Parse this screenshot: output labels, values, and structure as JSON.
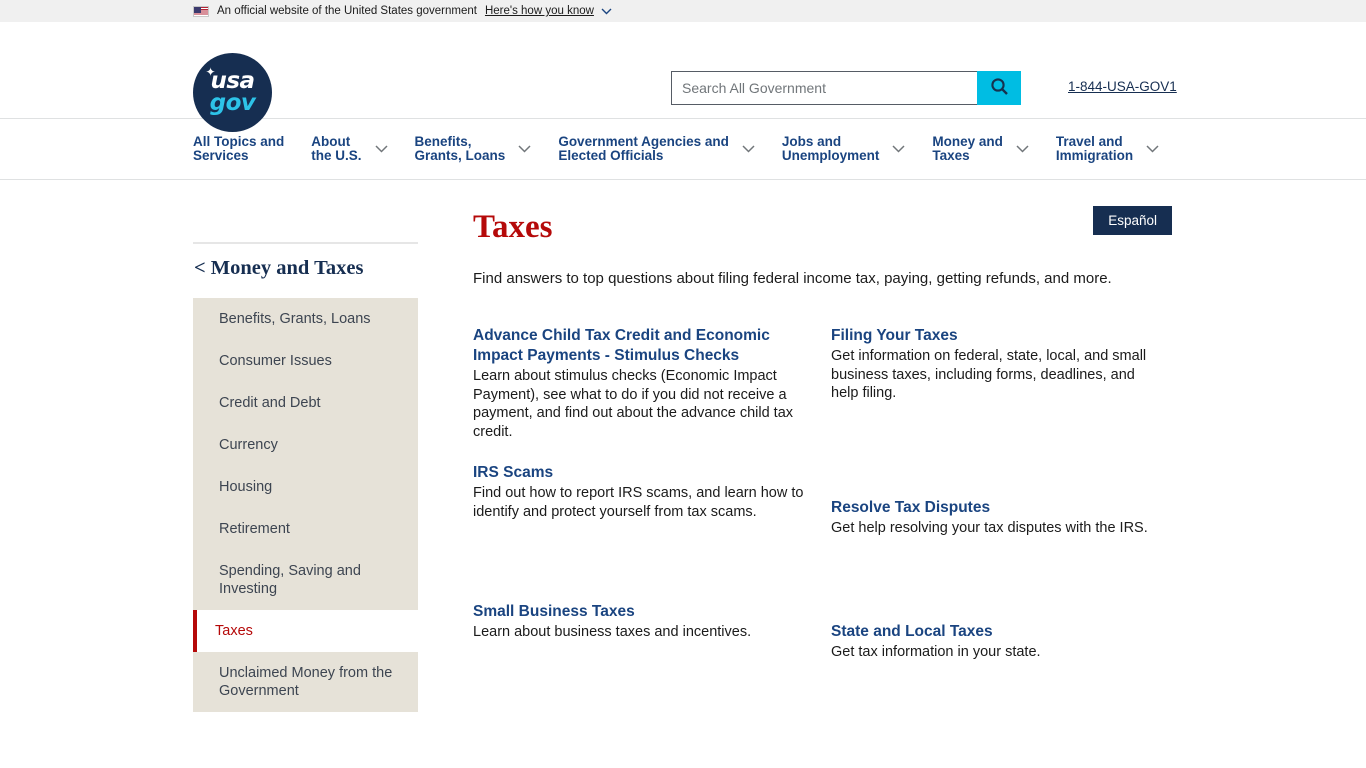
{
  "gov_banner": {
    "flag_icon": "us-flag-icon",
    "text": "An official website of the United States government",
    "link_text": "Here's how you know",
    "chevron_icon": "chevron-down-icon"
  },
  "header": {
    "logo": {
      "name": "usagov-logo",
      "line1": "usa",
      "line2": "gov",
      "star_icon": "star-icon"
    },
    "search": {
      "placeholder": "Search All Government",
      "value": "",
      "button_icon": "search-icon"
    },
    "phone": "1-844-USA-GOV1"
  },
  "nav": {
    "items": [
      {
        "label": "All Topics and\nServices",
        "has_chevron": false
      },
      {
        "label": "About\nthe U.S.",
        "has_chevron": true
      },
      {
        "label": "Benefits,\nGrants, Loans",
        "has_chevron": true
      },
      {
        "label": "Government Agencies and\nElected Officials",
        "has_chevron": true
      },
      {
        "label": "Jobs and\nUnemployment",
        "has_chevron": true
      },
      {
        "label": "Money and\nTaxes",
        "has_chevron": true
      },
      {
        "label": "Travel and\nImmigration",
        "has_chevron": true
      }
    ]
  },
  "page": {
    "language_button": "Español"
  },
  "sidebar": {
    "heading": "< Money and Taxes",
    "items": [
      {
        "label": "Benefits, Grants, Loans",
        "active": false
      },
      {
        "label": "Consumer Issues",
        "active": false
      },
      {
        "label": "Credit and Debt",
        "active": false
      },
      {
        "label": "Currency",
        "active": false
      },
      {
        "label": "Housing",
        "active": false
      },
      {
        "label": "Retirement",
        "active": false
      },
      {
        "label": "Spending, Saving and Investing",
        "active": false
      },
      {
        "label": "Taxes",
        "active": true
      },
      {
        "label": "Unclaimed Money from the Government",
        "active": false
      }
    ]
  },
  "main": {
    "title": "Taxes",
    "intro": "Find answers to top questions about filing federal income tax, paying, getting refunds, and more.",
    "cards": [
      {
        "title": "Advance Child Tax Credit and Economic Impact Payments - Stimulus Checks",
        "desc": "Learn about stimulus checks (Economic Impact Payment), see what to do if you did not receive a payment, and find out about the advance child tax credit."
      },
      {
        "title": "Filing Your Taxes",
        "desc": "Get information on federal, state, local, and small business taxes, including forms, deadlines, and help filing."
      },
      {
        "title": "IRS Scams",
        "desc": "Find out how to report IRS scams, and learn how to identify and protect yourself from tax scams."
      },
      {
        "title": "Resolve Tax Disputes",
        "desc": "Get help resolving your tax disputes with the IRS."
      },
      {
        "title": "Small Business Taxes",
        "desc": "Learn about business taxes and incentives."
      },
      {
        "title": "State and Local Taxes",
        "desc": "Get tax information in your state."
      }
    ]
  },
  "colors": {
    "navy": "#162e51",
    "link_blue": "#1a4480",
    "accent_red": "#b50909",
    "cyan": "#00bde3",
    "sidebar_bg": "#e6e2d8"
  }
}
